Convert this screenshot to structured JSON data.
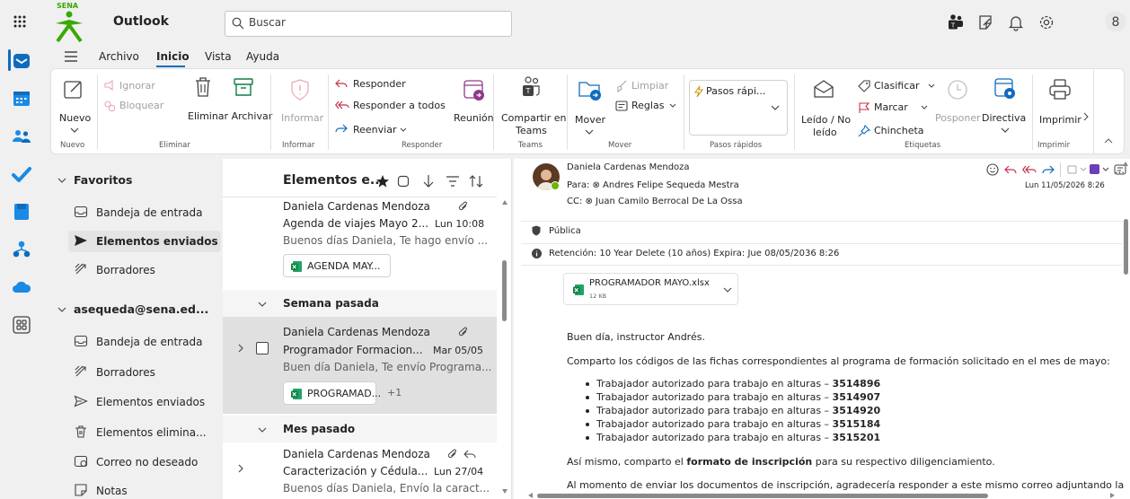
{
  "app": {
    "title": "Outlook",
    "brand": "SENA"
  },
  "search": {
    "placeholder": "Buscar"
  },
  "menu": {
    "tabs": [
      "Archivo",
      "Inicio",
      "Vista",
      "Ayuda"
    ],
    "active": "Inicio"
  },
  "ribbon": {
    "nuevo": "Nuevo",
    "ignorar": "Ignorar",
    "bloquear": "Bloquear",
    "eliminar_archivar": "Eliminar Archivar",
    "informar": "Informar",
    "responder": "Responder",
    "responder_todos": "Responder a todos",
    "reenviar": "Reenviar",
    "reunion": "Reunión",
    "compartir_1": "Compartir en",
    "compartir_2": "Teams",
    "mover": "Mover",
    "limpiar": "Limpiar",
    "reglas": "Reglas",
    "pasos": "Pasos rápi...",
    "leido_1": "Leído / No",
    "leido_2": "leído",
    "clasificar": "Clasificar",
    "marcar": "Marcar",
    "chincheta": "Chincheta",
    "posponer": "Posponer",
    "directiva": "Directiva",
    "imprimir": "Imprimir",
    "groups": {
      "nuevo": "Nuevo",
      "eliminar": "Eliminar",
      "informar": "Informar",
      "responder": "Responder",
      "teams": "Teams",
      "mover": "Mover",
      "pasos": "Pasos rápidos",
      "etiquetas": "Etiquetas",
      "imprimir": "Imprimir"
    }
  },
  "folders": {
    "favoritos": "Favoritos",
    "fav_items": [
      "Bandeja de entrada",
      "Elementos enviados",
      "Borradores"
    ],
    "account": "asequeda@sena.ed...",
    "acct_items": [
      "Bandeja de entrada",
      "Borradores",
      "Elementos enviados",
      "Elementos elimina...",
      "Correo no deseado",
      "Notas"
    ]
  },
  "list": {
    "title": "Elementos e...",
    "msg1": {
      "from": "Daniela Cardenas Mendoza",
      "subject": "Agenda de viajes Mayo 2...",
      "date": "Lun 10:08",
      "preview": "Buenos días Daniela, Te hago envío ...",
      "attachment": "AGENDA MAY..."
    },
    "group1": "Semana pasada",
    "msg2": {
      "from": "Daniela Cardenas Mendoza",
      "subject": "Programador Formacion...",
      "date": "Mar 05/05",
      "preview": "Buen día Daniela, Te envío Programa...",
      "attachment": "PROGRAMAD...",
      "more": "+1"
    },
    "group2": "Mes pasado",
    "msg3": {
      "from": "Daniela Cardenas Mendoza",
      "subject": "Caracterización y Cédula...",
      "date": "Lun 27/04",
      "preview": "Buenos días Daniela, Envío la caract..."
    }
  },
  "reading": {
    "from": "Daniela Cardenas Mendoza",
    "to": "Para: ⊗ Andres Felipe Sequeda Mestra",
    "cc": "CC: ⊗ Juan Camilo Berrocal De La Ossa",
    "date": "Lun 11/05/2026 8:26",
    "label": "Pública",
    "retention": "Retención: 10 Year Delete (10 años) Expira: Jue 08/05/2036 8:26",
    "attachment_name": "PROGRAMADOR MAYO.xlsx",
    "attachment_size": "12 KB",
    "greeting": "Buen día, instructor Andrés.",
    "para1": "Comparto los códigos de las fichas correspondientes al programa de formación solicitado en el mes de mayo:",
    "item_text": "Trabajador autorizado para trabajo en alturas – ",
    "codes": [
      "3514896",
      "3514907",
      "3514920",
      "3515184",
      "3515201"
    ],
    "para2_a": "Así mismo, comparto el ",
    "para2_b": "formato de inscripción",
    "para2_c": " para su respectivo diligenciamiento.",
    "para3": "Al momento de enviar los documentos de inscripción, agradecería responder a este mismo correo adjuntando la"
  },
  "colors": {
    "accent": "#0f6cbd",
    "sena_green": "#39a900",
    "excel_green": "#107c41",
    "selected": "#e0e0e0"
  }
}
